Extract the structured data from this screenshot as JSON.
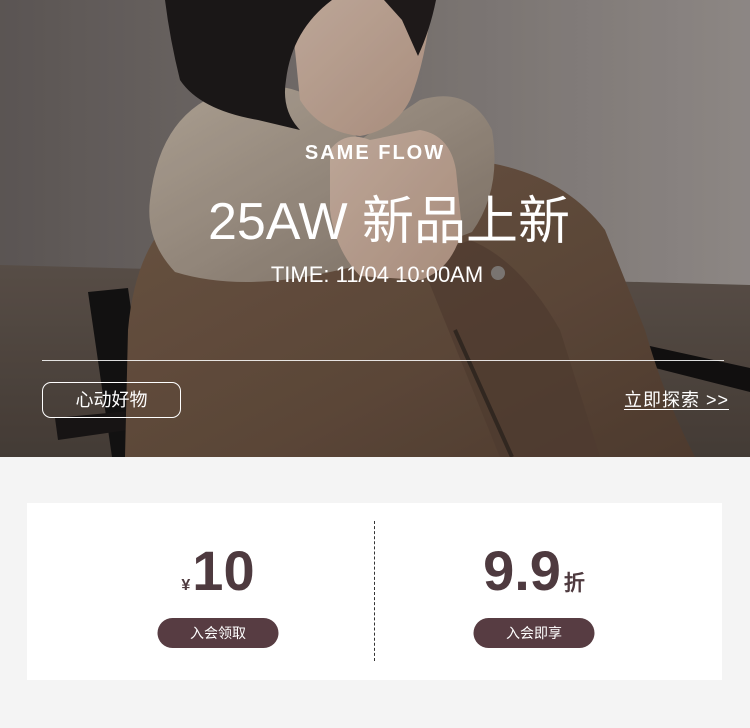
{
  "hero": {
    "eyebrow": "SAME FLOW",
    "title": "25AW 新品上新",
    "time": "TIME: 11/04 10:00AM",
    "tag_button": "心动好物",
    "explore_link": "立即探索 >>"
  },
  "coupons": [
    {
      "currency": "¥",
      "value": "10",
      "button": "入会领取"
    },
    {
      "value": "9.9",
      "unit": "折",
      "button": "入会即享"
    }
  ],
  "colors": {
    "brand": "#573c42",
    "value_text": "#4e3a3f",
    "page_bg": "#f4f4f4"
  }
}
